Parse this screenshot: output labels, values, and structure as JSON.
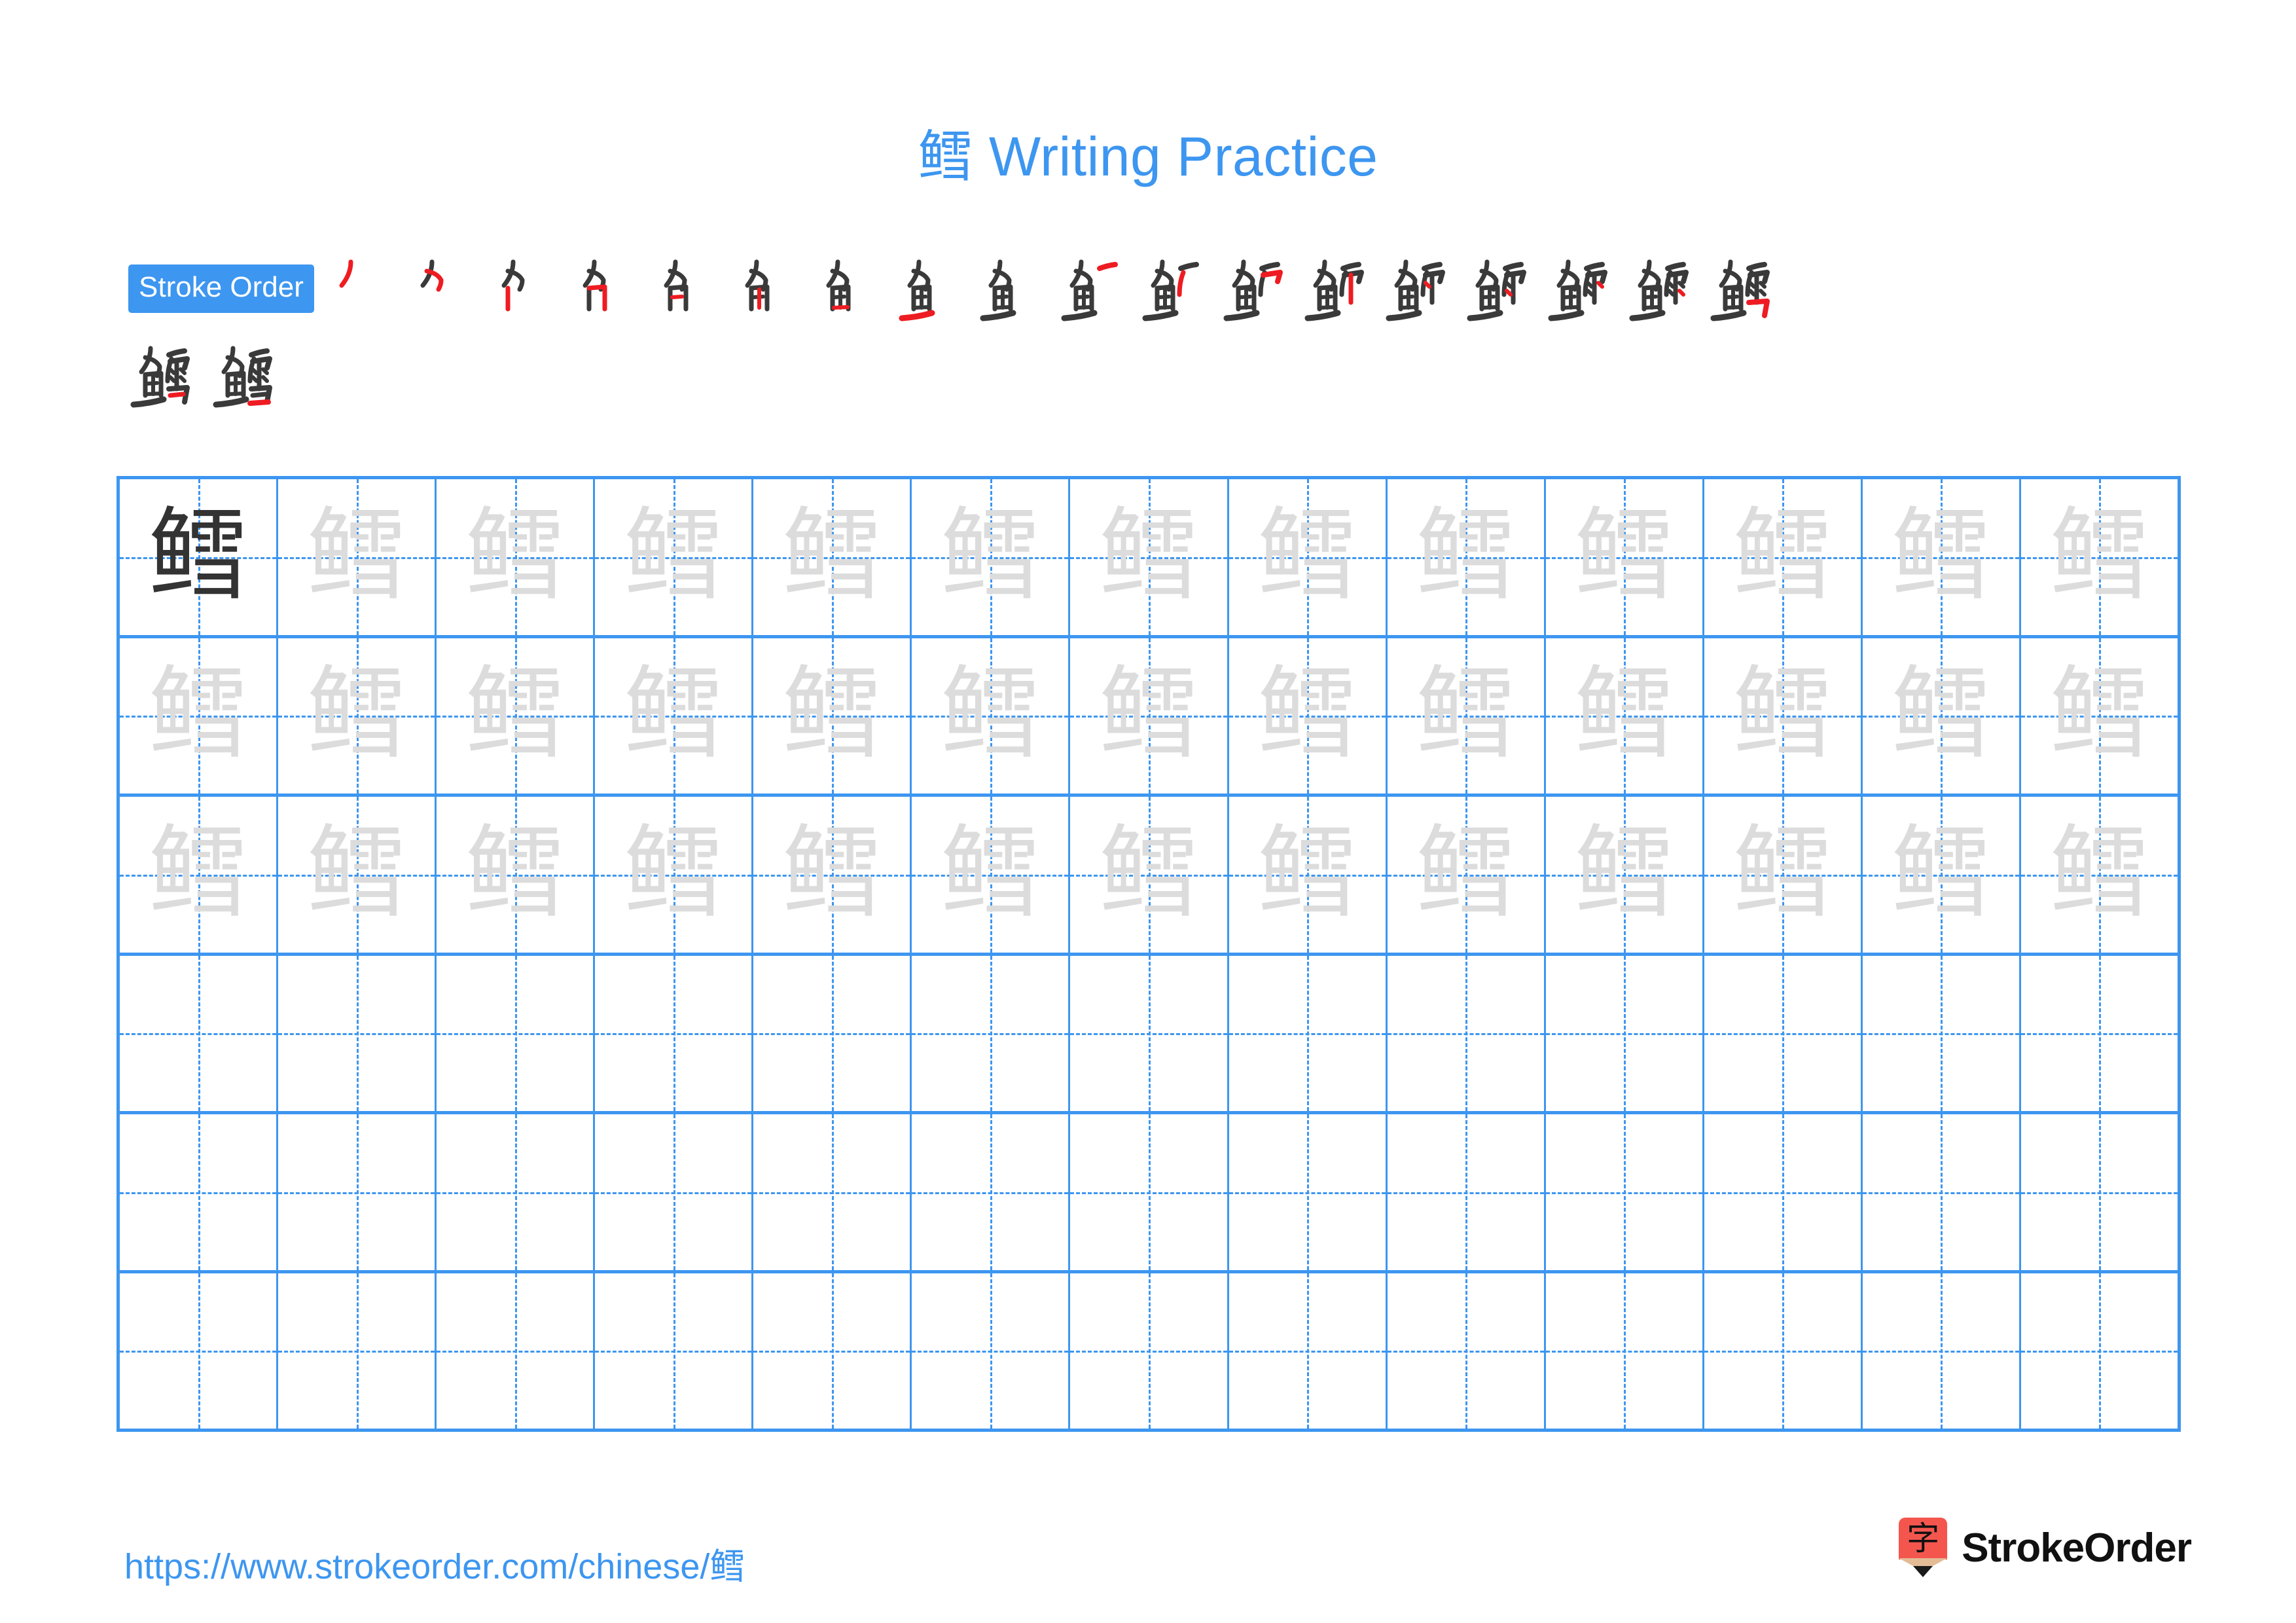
{
  "character": "鳕",
  "colors": {
    "accent_blue": "#3d96f0",
    "grid_blue": "#3d96f0",
    "ghost_gray": "#dcdcdc",
    "ink_dark": "#333333",
    "stroke_new_red": "#ee1c22",
    "logo_red": "#f4564e",
    "logo_wood": "#e3bb95"
  },
  "title": {
    "character": "鳕",
    "text": " Writing Practice"
  },
  "stroke_order": {
    "badge_label": "Stroke Order",
    "total_strokes": 20,
    "row1_count": 18,
    "row2_count": 2,
    "steps": [
      {
        "index": 1,
        "partial": "丿"
      },
      {
        "index": 2,
        "partial": "𠂊"
      },
      {
        "index": 3,
        "partial": "𠂊"
      },
      {
        "index": 4,
        "partial": "勹"
      },
      {
        "index": 5,
        "partial": "㇒"
      },
      {
        "index": 6,
        "partial": "⺈"
      },
      {
        "index": 7,
        "partial": "𢆉"
      },
      {
        "index": 8,
        "partial": "鱼"
      },
      {
        "index": 9,
        "partial": "鱼"
      },
      {
        "index": 10,
        "partial": "鱼一"
      },
      {
        "index": 11,
        "partial": "鱼⺈"
      },
      {
        "index": 12,
        "partial": "鱼⺕"
      },
      {
        "index": 13,
        "partial": "鱼⺕"
      },
      {
        "index": 14,
        "partial": "鳕"
      },
      {
        "index": 15,
        "partial": "鳕"
      },
      {
        "index": 16,
        "partial": "鳕"
      },
      {
        "index": 17,
        "partial": "鳕"
      },
      {
        "index": 18,
        "partial": "鳕"
      },
      {
        "index": 19,
        "partial": "鳕"
      },
      {
        "index": 20,
        "partial": "鳕"
      }
    ]
  },
  "practice_grid": {
    "columns": 13,
    "rows": 6,
    "traced_rows": 3,
    "empty_rows": 3,
    "model_cell": {
      "row": 1,
      "column": 1,
      "character": "鳕",
      "style": "dark"
    },
    "ghost_character": "鳕"
  },
  "footer": {
    "url_text": "https://www.strokeorder.com/chinese/",
    "url_character": "鳕",
    "brand_name": "StrokeOrder",
    "brand_mark_char": "字"
  }
}
